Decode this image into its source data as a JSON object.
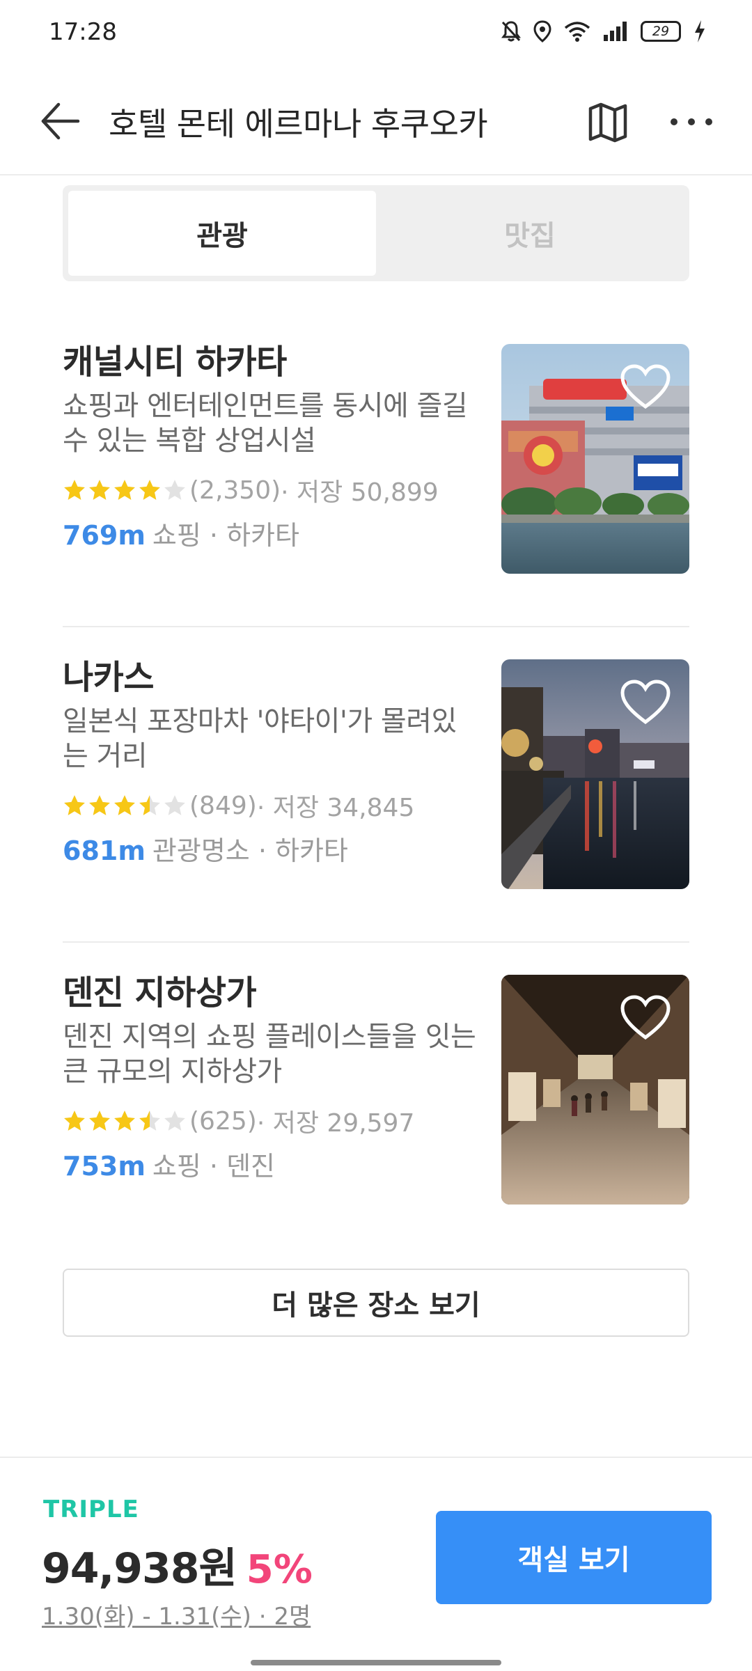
{
  "status_bar": {
    "time": "17:28",
    "battery": "29",
    "icons": [
      "mute-icon",
      "location-icon",
      "wifi-icon",
      "signal-icon",
      "battery-icon",
      "charging-icon"
    ]
  },
  "header": {
    "title": "호텔 몬테 에르마나 후쿠오카",
    "back_icon": "arrow-left-icon",
    "map_icon": "map-icon",
    "more_icon": "more-horizontal-icon"
  },
  "tabs": [
    {
      "label": "관광",
      "active": true
    },
    {
      "label": "맛집",
      "active": false
    }
  ],
  "places": [
    {
      "name": "캐널시티 하카타",
      "description": "쇼핑과 엔터테인먼트를 동시에 즐길 수 있는 복합 상업시설",
      "rating": 4,
      "reviews": "(2,350)",
      "saves": " · 저장 50,899",
      "distance": "769m",
      "category": "쇼핑 · 하카타"
    },
    {
      "name": "나카스",
      "description": "일본식 포장마차 '야타이'가 몰려있는 거리",
      "rating": 3.5,
      "reviews": "(849)",
      "saves": " · 저장 34,845",
      "distance": "681m",
      "category": "관광명소 · 하카타"
    },
    {
      "name": "덴진 지하상가",
      "description": "덴진 지역의 쇼핑 플레이스들을 잇는 큰 규모의 지하상가",
      "rating": 3.5,
      "reviews": "(625)",
      "saves": " · 저장 29,597",
      "distance": "753m",
      "category": "쇼핑 · 덴진"
    }
  ],
  "more_places_label": "더 많은 장소 보기",
  "booking": {
    "brand": "TRIPLE",
    "price": "94,938원",
    "discount": "5%",
    "dates": "1.30(화) - 1.31(수) · 2명",
    "button_label": "객실 보기"
  },
  "colors": {
    "accent_blue": "#368ff7",
    "distance_blue": "#3d8ae6",
    "brand_green": "#1fc6a6",
    "discount_pink": "#f2457a",
    "star_yellow": "#f7c716"
  }
}
